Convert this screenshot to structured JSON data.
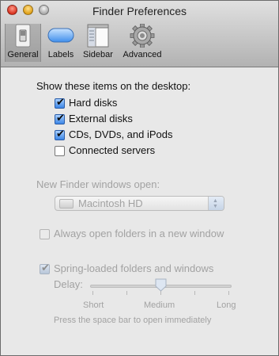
{
  "window": {
    "title": "Finder Preferences"
  },
  "toolbar": {
    "items": [
      {
        "label": "General",
        "icon": "light-switch-icon",
        "selected": true
      },
      {
        "label": "Labels",
        "icon": "label-pill-icon",
        "selected": false
      },
      {
        "label": "Sidebar",
        "icon": "sidebar-window-icon",
        "selected": false
      },
      {
        "label": "Advanced",
        "icon": "gear-icon",
        "selected": false
      }
    ]
  },
  "desktop": {
    "heading": "Show these items on the desktop:",
    "items": [
      {
        "label": "Hard disks",
        "checked": true
      },
      {
        "label": "External disks",
        "checked": true
      },
      {
        "label": "CDs, DVDs, and iPods",
        "checked": true
      },
      {
        "label": "Connected servers",
        "checked": false
      }
    ]
  },
  "new_window": {
    "label": "New Finder windows open:",
    "value": "Macintosh HD"
  },
  "always_open": {
    "label": "Always open folders in a new window",
    "checked": false
  },
  "spring": {
    "label": "Spring-loaded folders and windows",
    "checked": true,
    "delay_label": "Delay:",
    "slider_labels": [
      "Short",
      "Medium",
      "Long"
    ],
    "slider_value": 0.5,
    "note": "Press the space bar to open immediately"
  }
}
